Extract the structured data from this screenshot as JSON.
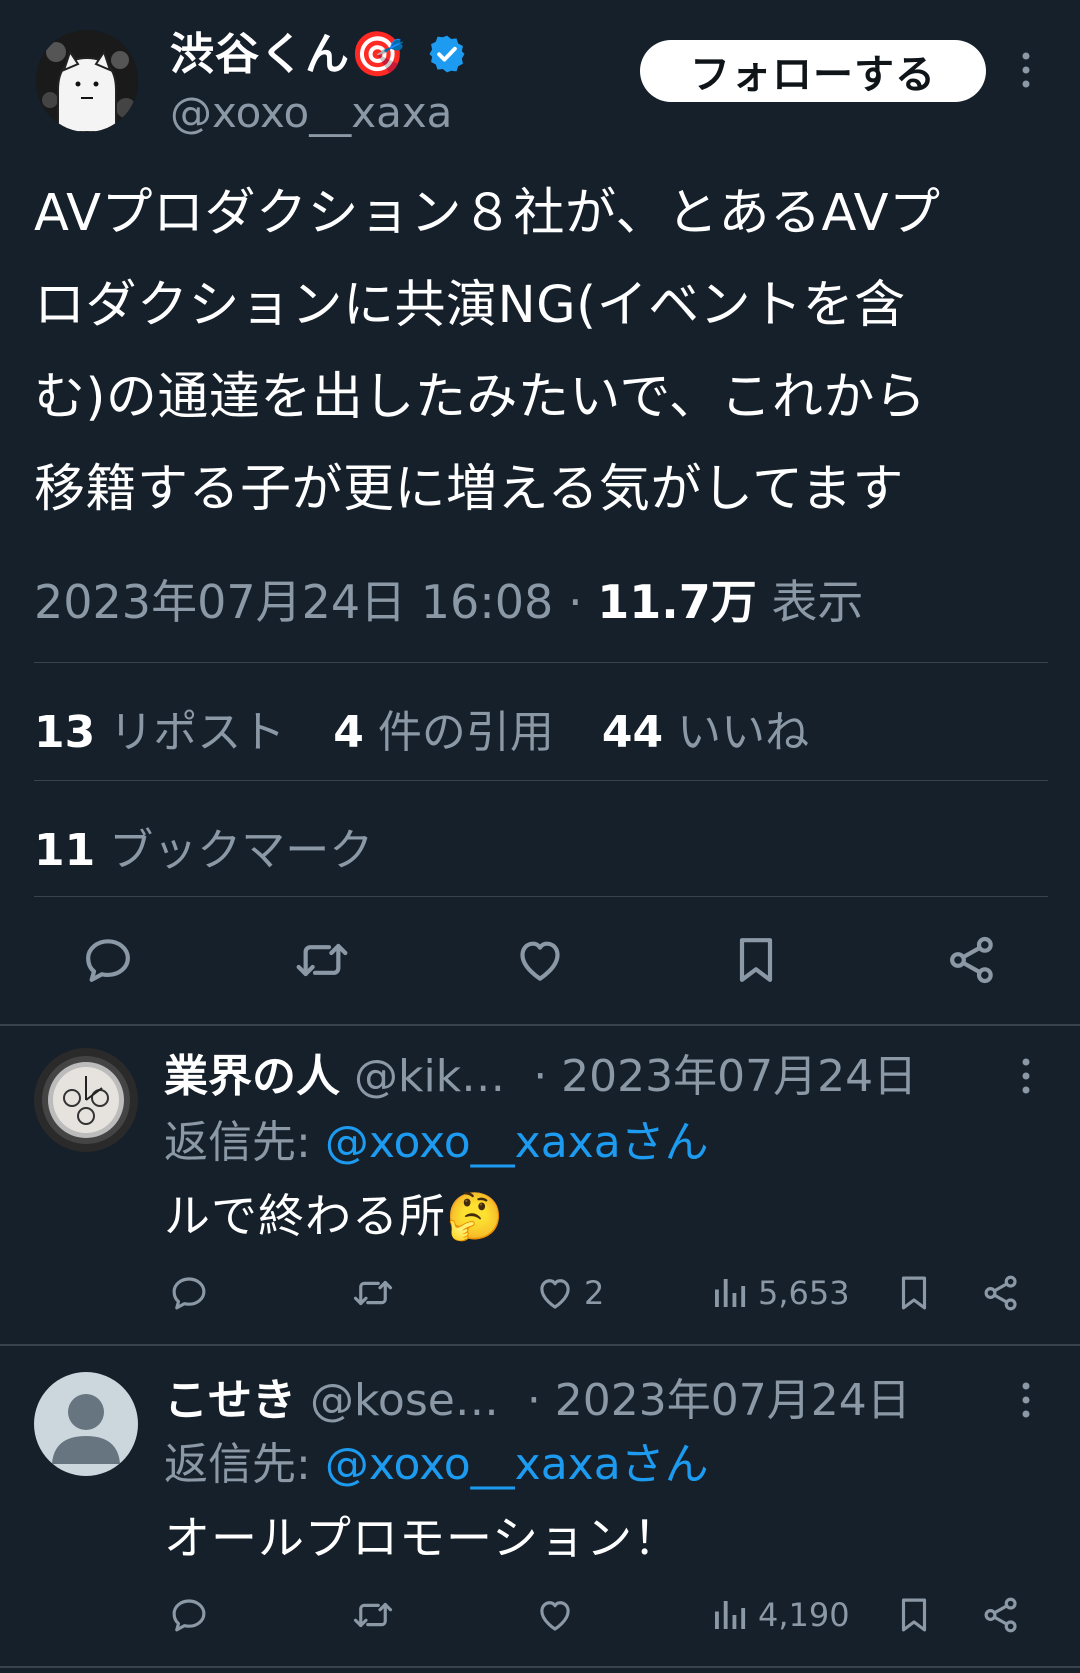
{
  "tweet": {
    "display_name": "渋谷くん🎯",
    "handle": "@xoxo__xaxa",
    "follow_label": "フォローする",
    "text_lines": [
      "AVプロダクション８社が、とあるAVプ",
      "ロダクションに共演NG(イベントを含",
      "む)の通達を出したみたいで、これから",
      "移籍する子が更に増える気がしてます"
    ],
    "timestamp": "2023年07月24日 16:08",
    "separator": " · ",
    "views_count": "11.7万",
    "views_label": " 表示",
    "stats": {
      "reposts_count": "13",
      "reposts_label": " リポスト",
      "quotes_count": "4",
      "quotes_label": " 件の引用",
      "likes_count": "44",
      "likes_label": " いいね",
      "bookmarks_count": "11",
      "bookmarks_label": " ブックマーク"
    }
  },
  "replies": [
    {
      "display_name": "業界の人",
      "handle": "@kik…",
      "date": "· 2023年07月24日",
      "reply_to_label": "返信先: ",
      "reply_to_handle": "@xoxo__xaxaさん",
      "text": "ルで終わる所🤔",
      "likes": "2",
      "views": "5,653"
    },
    {
      "display_name": "こせき",
      "handle": "@kose…",
      "date": "· 2023年07月24日",
      "reply_to_label": "返信先: ",
      "reply_to_handle": "@xoxo__xaxaさん",
      "text": "オールプロモーション！",
      "likes": "",
      "views": "4,190"
    }
  ],
  "colors": {
    "background": "#15202b",
    "text_secondary": "#8b98a5",
    "accent": "#1d9bf0",
    "divider": "#38444d"
  }
}
